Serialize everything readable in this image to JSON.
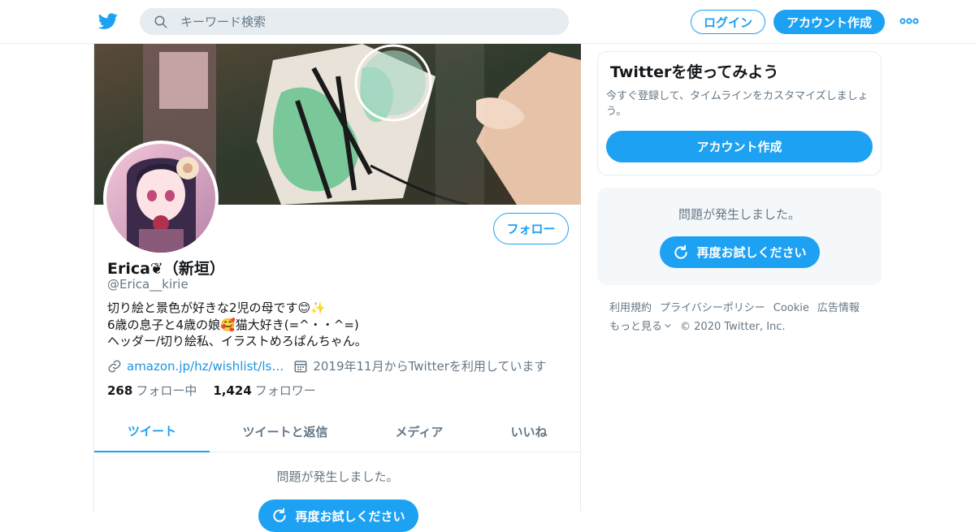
{
  "topbar": {
    "search_placeholder": "キーワード検索",
    "login_label": "ログイン",
    "signup_label": "アカウント作成"
  },
  "profile": {
    "name": "Erica❦（新垣）",
    "handle": "@Erica__kirie",
    "bio_lines": [
      "切り絵と景色が好きな2児の母です😊✨",
      "6歳の息子と4歳の娘🥰猫大好き(=^・・^=)",
      "ヘッダー/切り絵私、イラストめろぱんちゃん。"
    ],
    "link": "amazon.jp/hz/wishlist/ls…",
    "joined": "2019年11月からTwitterを利用しています",
    "following_count": "268",
    "following_label": "フォロー中",
    "followers_count": "1,424",
    "followers_label": "フォロワー",
    "follow_button": "フォロー"
  },
  "tabs": [
    {
      "label": "ツイート",
      "active": true
    },
    {
      "label": "ツイートと返信",
      "active": false
    },
    {
      "label": "メディア",
      "active": false
    },
    {
      "label": "いいね",
      "active": false
    }
  ],
  "main": {
    "error_text": "問題が発生しました。",
    "retry_label": "再度お試しください"
  },
  "sidebar": {
    "card_title": "Twitterを使ってみよう",
    "card_sub": "今すぐ登録して、タイムラインをカスタマイズしましょう。",
    "card_button": "アカウント作成",
    "error_text": "問題が発生しました。",
    "retry_label": "再度お試しください"
  },
  "footer": {
    "links": [
      "利用規約",
      "プライバシーポリシー",
      "Cookie",
      "広告情報"
    ],
    "more": "もっと見る",
    "copyright": "© 2020 Twitter, Inc."
  },
  "colors": {
    "accent": "#1da1f2",
    "secondary_text": "#657786",
    "border": "#e6ecf0"
  },
  "icons": {
    "logo": "twitter-bird-icon",
    "search": "search-icon",
    "more": "more-dots-icon",
    "link": "link-icon",
    "calendar": "calendar-icon",
    "retry": "retry-icon",
    "chevron": "chevron-down-icon"
  }
}
